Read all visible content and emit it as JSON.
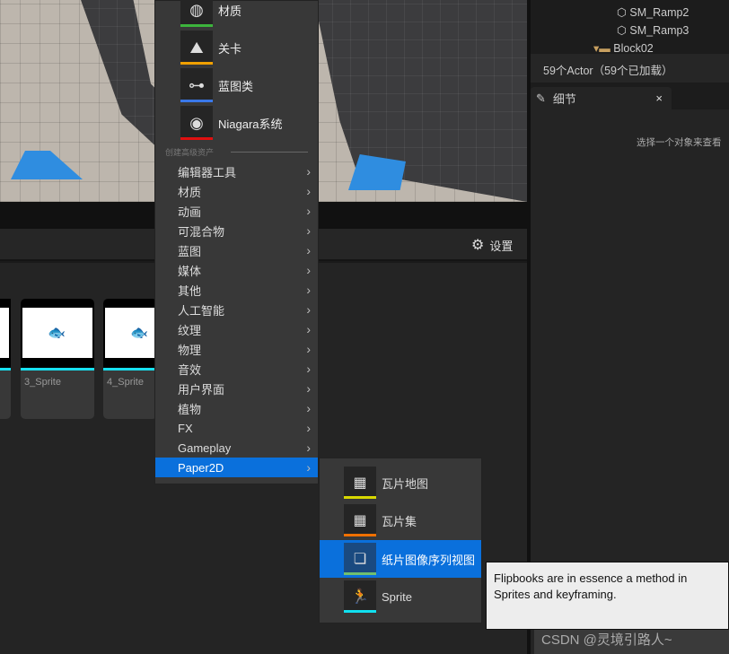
{
  "outliner": {
    "items": [
      "SM_Ramp2",
      "SM_Ramp3",
      "Block02"
    ],
    "status": "59个Actor（59个已加载）"
  },
  "details": {
    "tab": "细节",
    "close": "×",
    "hint": "选择一个对象来查看"
  },
  "content_browser": {
    "settings": "设置",
    "thumbnails": [
      "3_Sprite",
      "4_Sprite"
    ],
    "accent": "#17e0f0"
  },
  "menu": {
    "big_items": [
      {
        "label": "材质",
        "color": "#3cb43c",
        "icon": "checker-sphere-icon"
      },
      {
        "label": "关卡",
        "color": "#f0a000",
        "icon": "mountain-icon"
      },
      {
        "label": "蓝图类",
        "color": "#3a78e8",
        "icon": "blueprint-node-icon"
      },
      {
        "label": "Niagara系统",
        "color": "#e01010",
        "icon": "niagara-cube-icon"
      }
    ],
    "section": "创建高级资产",
    "items": [
      "编辑器工具",
      "材质",
      "动画",
      "可混合物",
      "蓝图",
      "媒体",
      "其他",
      "人工智能",
      "纹理",
      "物理",
      "音效",
      "用户界面",
      "植物",
      "FX",
      "Gameplay",
      "Paper2D"
    ],
    "selected": "Paper2D",
    "highlight": "#0a70dc"
  },
  "submenu": {
    "items": [
      {
        "label": "瓦片地图",
        "color": "#d8d800",
        "icon": "tile-grid-icon"
      },
      {
        "label": "瓦片集",
        "color": "#f07000",
        "icon": "tile-grid-icon"
      },
      {
        "label": "纸片图像序列视图",
        "color": "#70c070",
        "icon": "flipbook-icon"
      },
      {
        "label": "Sprite",
        "color": "#10e0f0",
        "icon": "sprite-runner-icon"
      }
    ],
    "selected": "纸片图像序列视图"
  },
  "tooltip": {
    "line1": "Flipbooks are in essence a method in",
    "line2": "Sprites and keyframing."
  },
  "watermark": "CSDN @灵境引路人~"
}
